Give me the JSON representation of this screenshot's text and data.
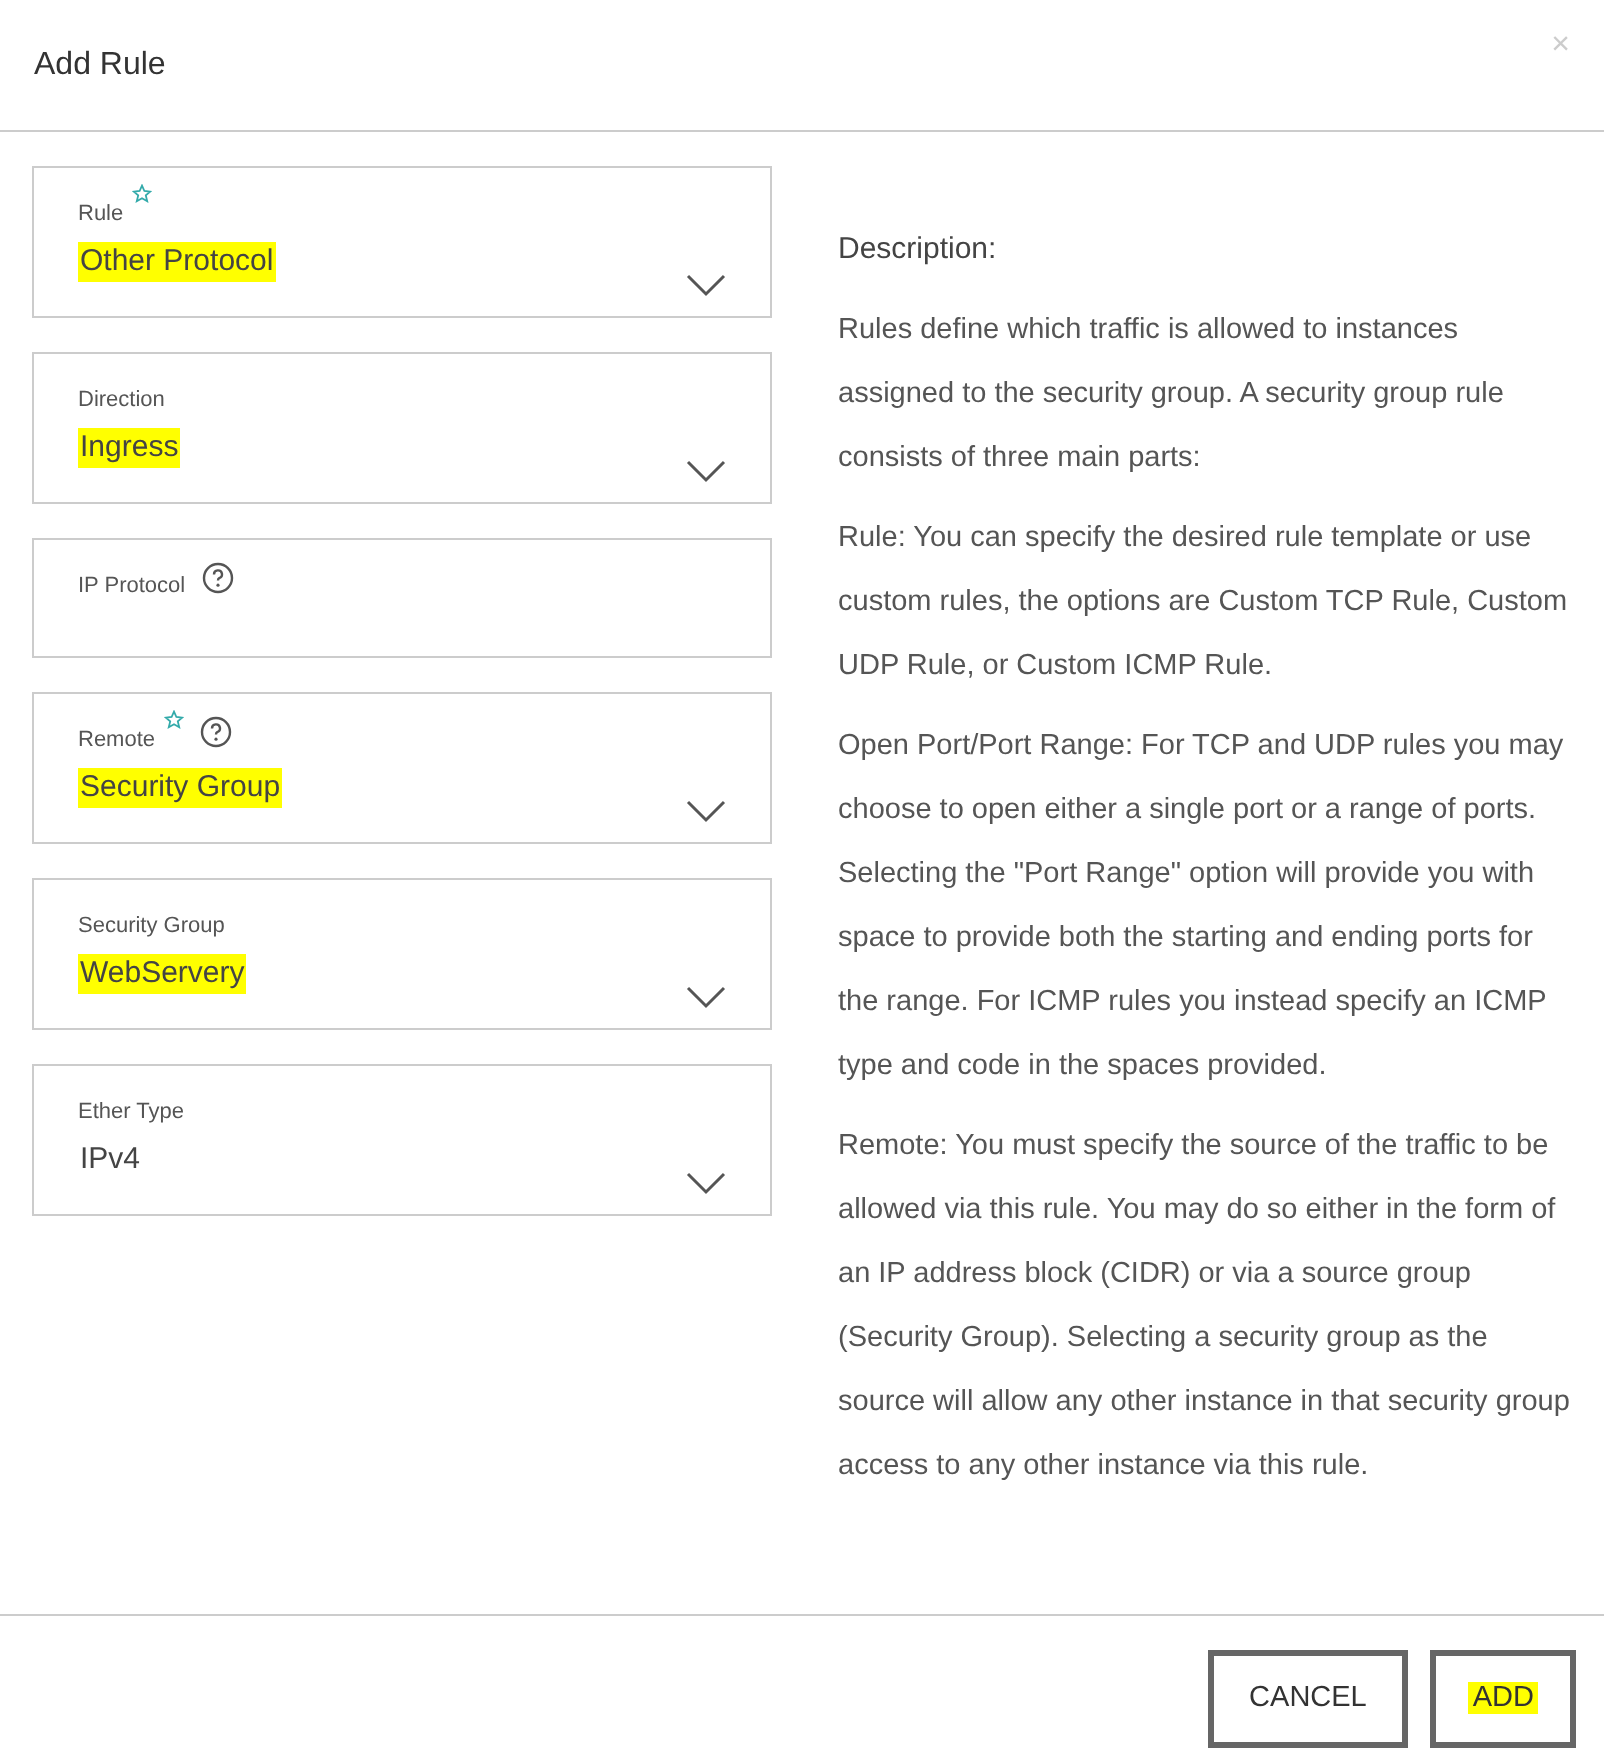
{
  "dialog": {
    "title": "Add Rule",
    "close": "×"
  },
  "fields": [
    {
      "kind": "select",
      "label": "Rule",
      "required": true,
      "help": false,
      "value": "Other Protocol",
      "highlighted": true
    },
    {
      "kind": "select",
      "label": "Direction",
      "required": false,
      "help": false,
      "value": "Ingress",
      "highlighted": true
    },
    {
      "kind": "text",
      "label": "IP Protocol",
      "required": false,
      "help": true
    },
    {
      "kind": "select",
      "label": "Remote",
      "required": true,
      "help": true,
      "value": "Security Group",
      "highlighted": true
    },
    {
      "kind": "select",
      "label": "Security Group",
      "required": false,
      "help": false,
      "value": "WebServery",
      "highlighted": true
    },
    {
      "kind": "select",
      "label": "Ether Type",
      "required": false,
      "help": false,
      "value": "IPv4",
      "highlighted": false
    }
  ],
  "description": {
    "heading": "Description:",
    "paragraphs": [
      "Rules define which traffic is allowed to instances assigned to the security group. A security group rule consists of three main parts:",
      "Rule: You can specify the desired rule template or use custom rules, the options are Custom TCP Rule, Custom UDP Rule, or Custom ICMP Rule.",
      "Open Port/Port Range: For TCP and UDP rules you may choose to open either a single port or a range of ports. Selecting the \"Port Range\" option will provide you with space to provide both the starting and ending ports for the range. For ICMP rules you instead specify an ICMP type and code in the spaces provided.",
      "Remote: You must specify the source of the traffic to be allowed via this rule. You may do so either in the form of an IP address block (CIDR) or via a source group (Security Group). Selecting a security group as the source will allow any other instance in that security group access to any other instance via this rule."
    ]
  },
  "buttons": [
    {
      "label": "CANCEL",
      "highlighted": false
    },
    {
      "label": "ADD",
      "highlighted": true
    }
  ]
}
